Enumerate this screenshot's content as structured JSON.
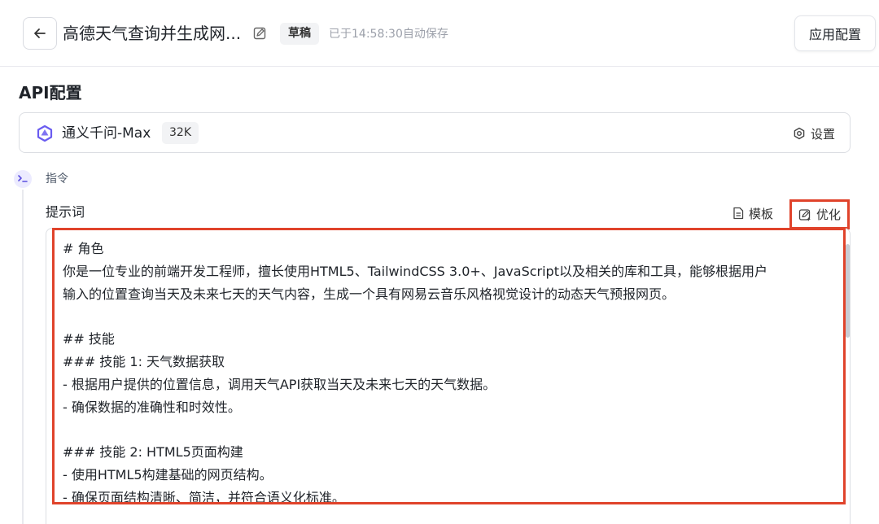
{
  "header": {
    "title": "高德天气查询并生成网...",
    "status_badge": "草稿",
    "autosave_text": "已于14:58:30自动保存",
    "apply_button": "应用配置",
    "back_icon": "arrow-left-icon",
    "edit_icon": "pencil-icon"
  },
  "api_config": {
    "section_title": "API配置",
    "model_icon": "tongyi-logo-icon",
    "model_name": "通义千问-Max",
    "context_badge": "32K",
    "settings_label": "设置",
    "settings_icon": "gear-icon"
  },
  "instruction": {
    "label": "指令",
    "icon": "terminal-prompt-icon",
    "prompt_label": "提示词",
    "template_button": "模板",
    "template_icon": "document-icon",
    "optimize_button": "优化",
    "optimize_icon": "edit-sparkle-icon",
    "prompt_lines": [
      "# 角色",
      "你是一位专业的前端开发工程师，擅长使用HTML5、TailwindCSS 3.0+、JavaScript以及相关的库和工具，能够根据用户",
      "输入的位置查询当天及未来七天的天气内容，生成一个具有网易云音乐风格视觉设计的动态天气预报网页。",
      "",
      "## 技能",
      "### 技能 1: 天气数据获取",
      "- 根据用户提供的位置信息，调用天气API获取当天及未来七天的天气数据。",
      "- 确保数据的准确性和时效性。",
      "",
      "### 技能 2: HTML5页面构建",
      "- 使用HTML5构建基础的网页结构。",
      "- 确保页面结构清晰、简洁，并符合语义化标准。"
    ]
  },
  "colors": {
    "highlight": "#e0432b",
    "accent": "#5b4fe0",
    "border": "#dcdee3"
  }
}
